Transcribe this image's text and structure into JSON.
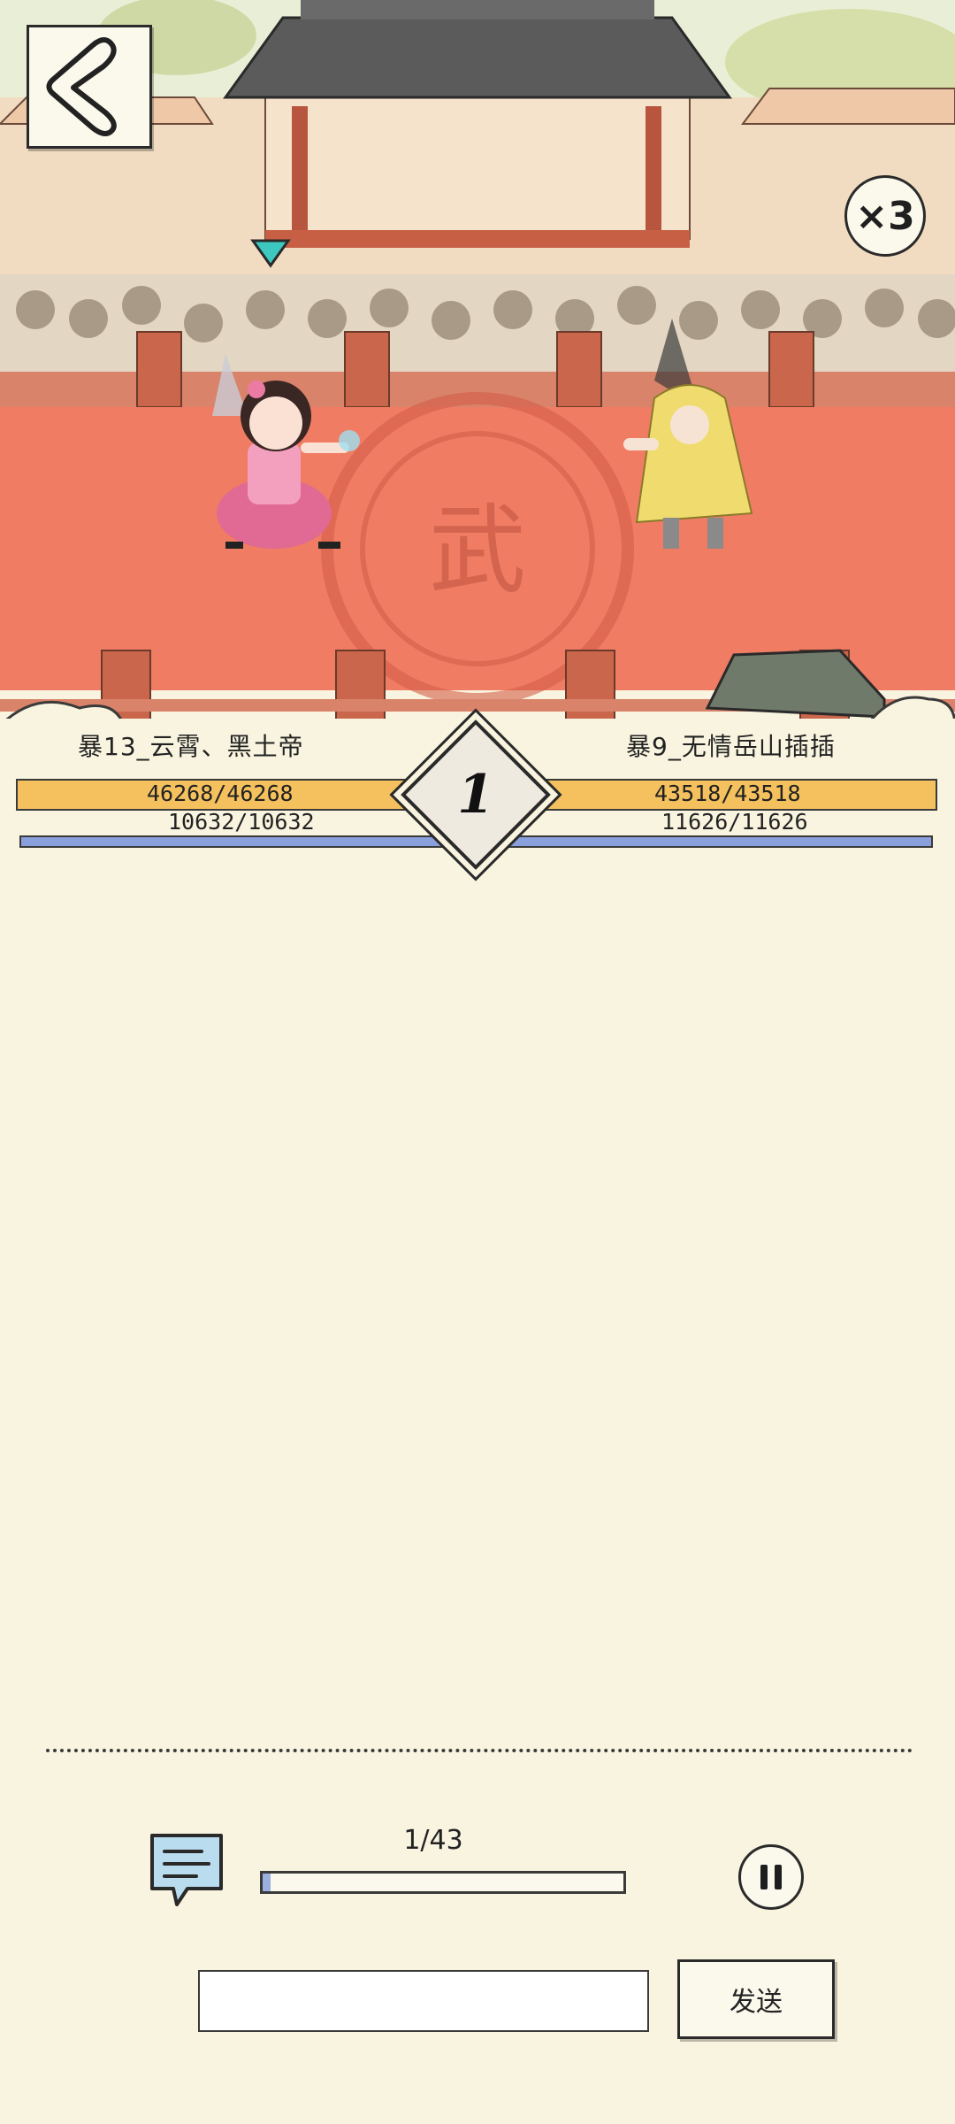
{
  "arena": {
    "floor_emblem": "武"
  },
  "speed": {
    "label": "×3"
  },
  "player_left": {
    "name": "暴13_云霄、黑土帝",
    "hp_text": "46268/46268",
    "mp_text": "10632/10632",
    "hp_fraction": 1.0,
    "mp_fraction": 1.0
  },
  "player_right": {
    "name": "暴9_无情岳山插插",
    "hp_text": "43518/43518",
    "mp_text": "11626/11626",
    "hp_fraction": 1.0,
    "mp_fraction": 1.0
  },
  "round": {
    "number": "1"
  },
  "playback": {
    "progress_label": "1/43",
    "current": 1,
    "total": 43
  },
  "chat": {
    "input_value": "",
    "send_label": "发送"
  },
  "icons": {
    "back": "chevron-left-icon",
    "chat": "chat-bubble-icon",
    "pause": "pause-icon",
    "marker": "triangle-marker-icon"
  },
  "colors": {
    "hp_bar": "#f4c15e",
    "mp_bar": "#8aa0dc",
    "arena_floor": "#f07c63",
    "marker": "#3ec9c0",
    "background": "#f8f4df"
  }
}
